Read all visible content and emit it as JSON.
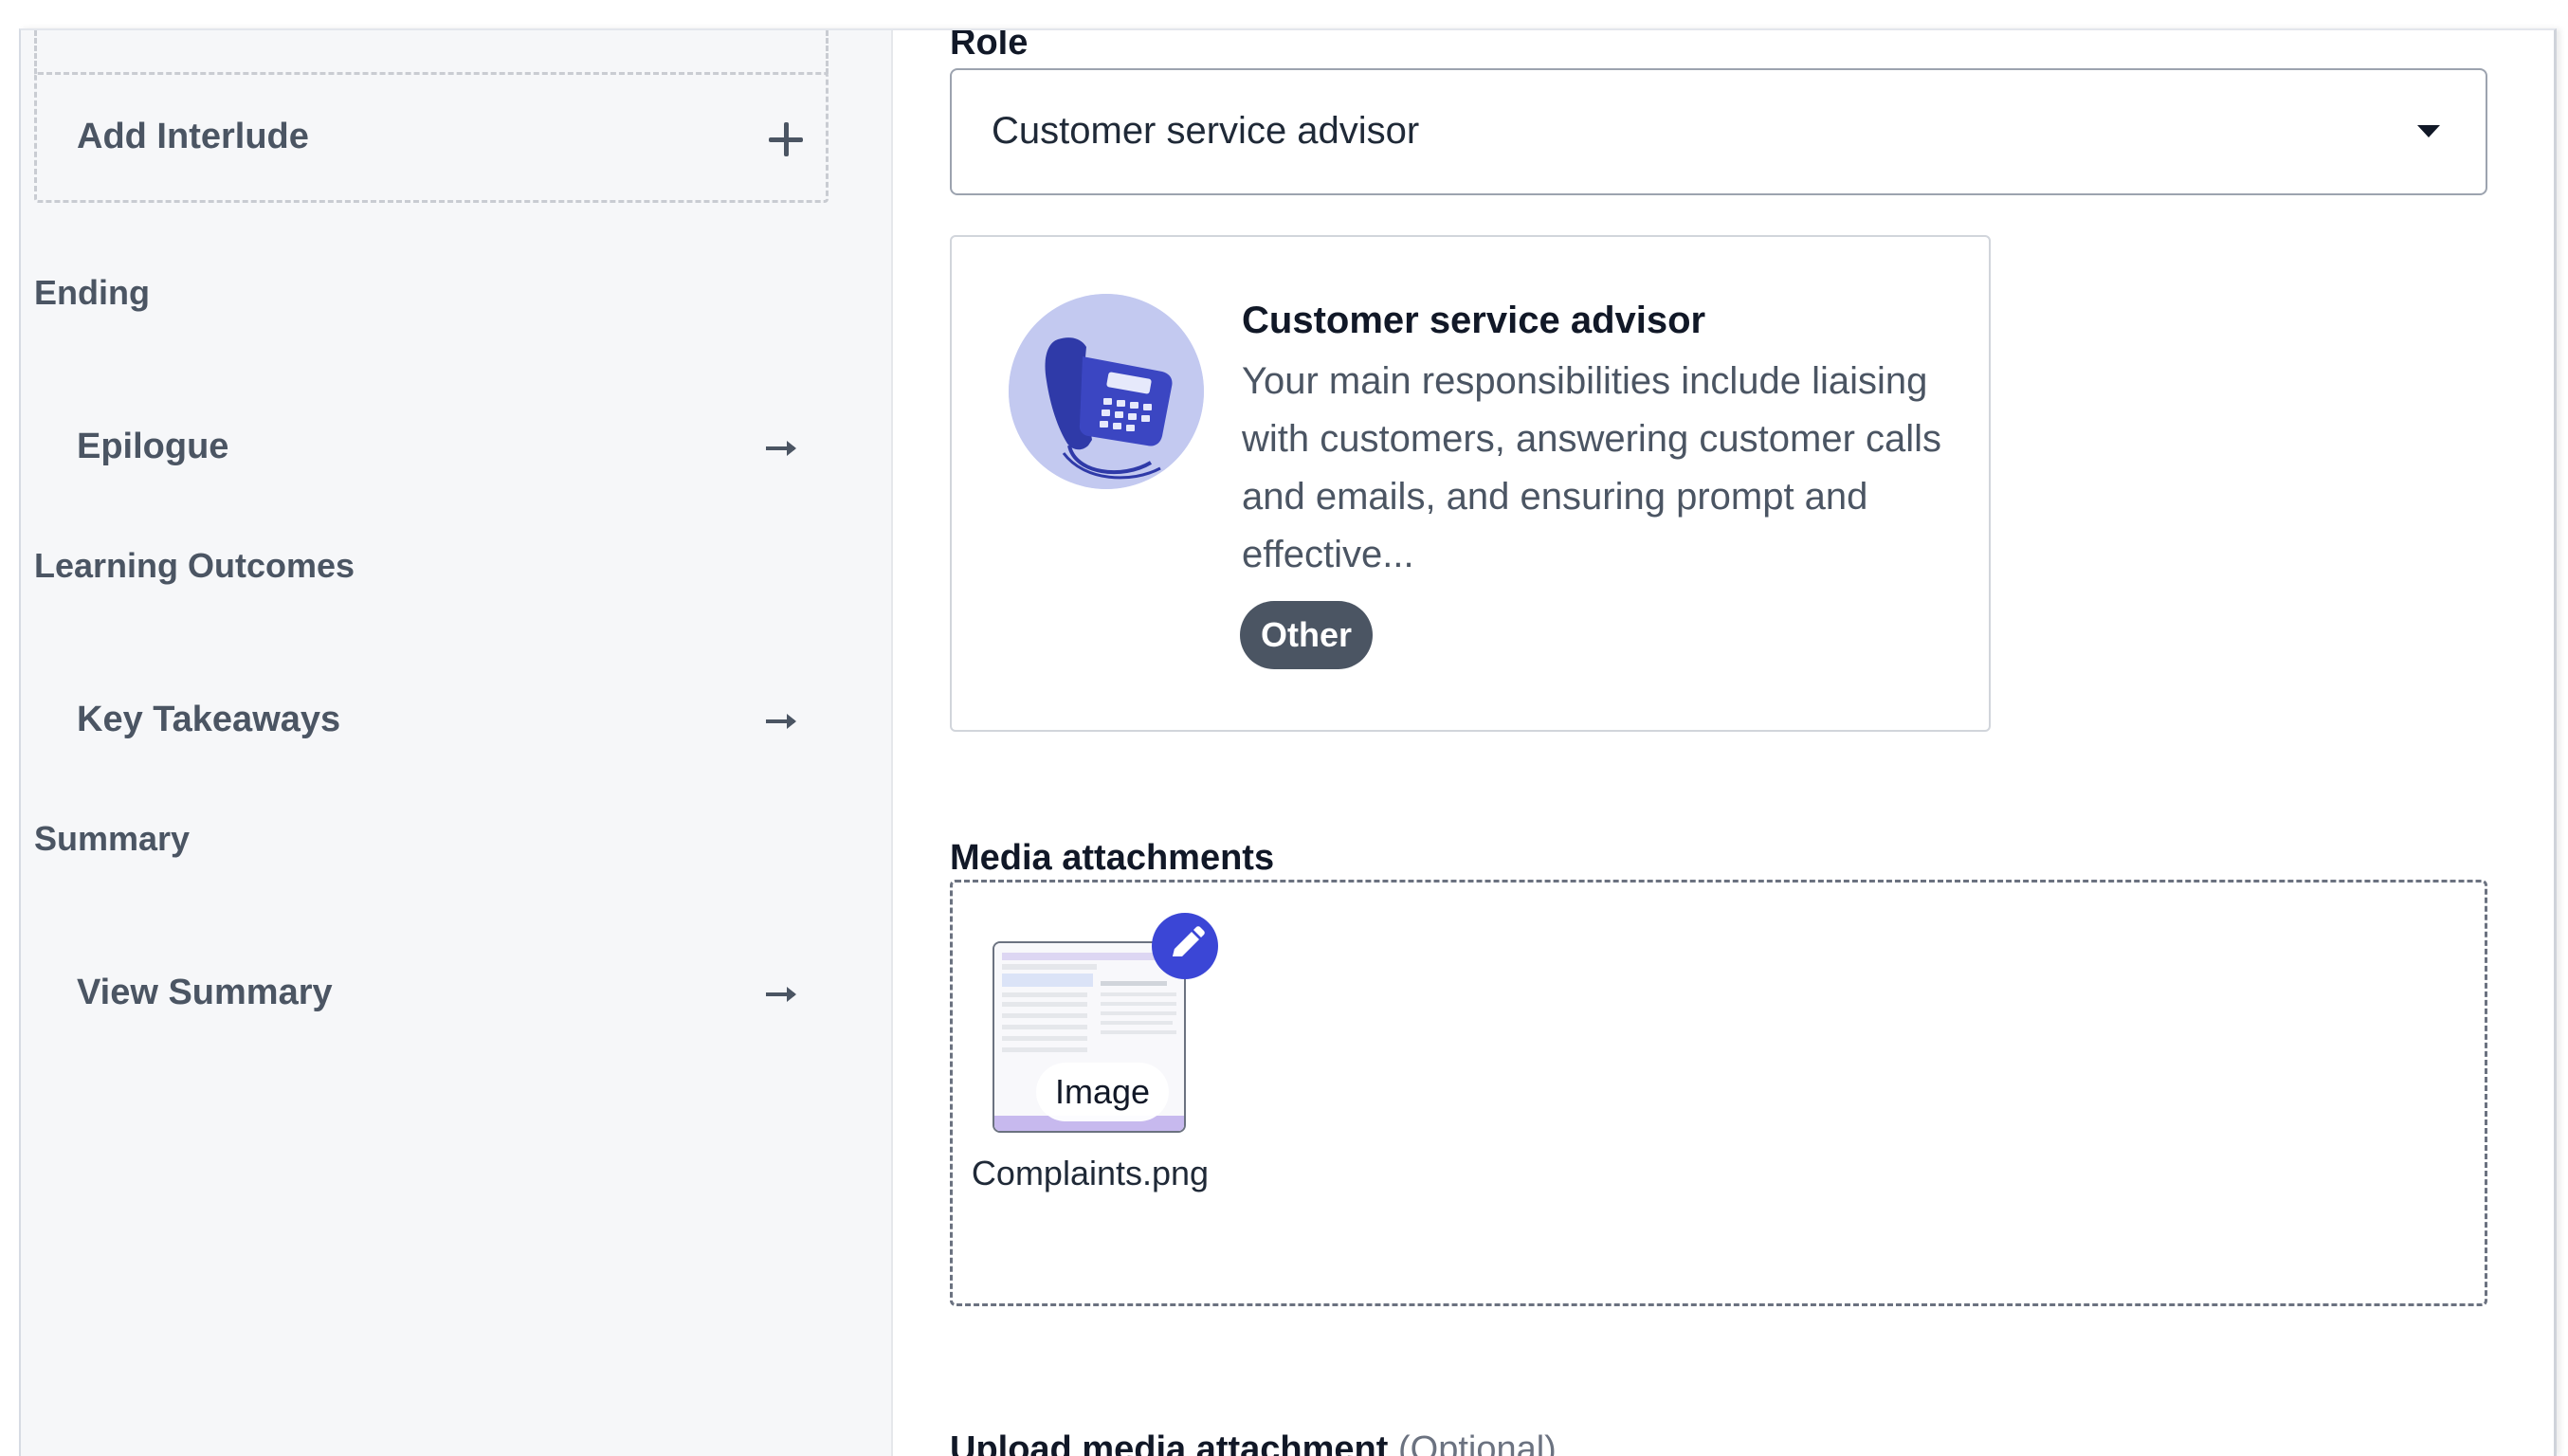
{
  "sidebar": {
    "add_interlude_label": "Add Interlude",
    "sections": [
      {
        "heading": "Ending",
        "item": "Epilogue"
      },
      {
        "heading": "Learning Outcomes",
        "item": "Key Takeaways"
      },
      {
        "heading": "Summary",
        "item": "View Summary"
      }
    ]
  },
  "main": {
    "role_label": "Role",
    "role_select_value": "Customer service advisor",
    "role_card": {
      "title": "Customer service advisor",
      "description": "Your main responsibilities include liaising with customers, answering customer calls and emails, and ensuring prompt and effective...",
      "tag": "Other",
      "image_icon": "telephone-icon"
    },
    "media_label": "Media attachments",
    "attachment": {
      "type_badge": "Image",
      "file_name": "Complaints.png",
      "edit_icon": "pencil-icon"
    },
    "upload_label": "Upload media attachment",
    "upload_optional": "(Optional)"
  },
  "colors": {
    "accent": "#3b46d6",
    "tag_bg": "#4b5563",
    "sidebar_bg": "#f6f7f9"
  }
}
